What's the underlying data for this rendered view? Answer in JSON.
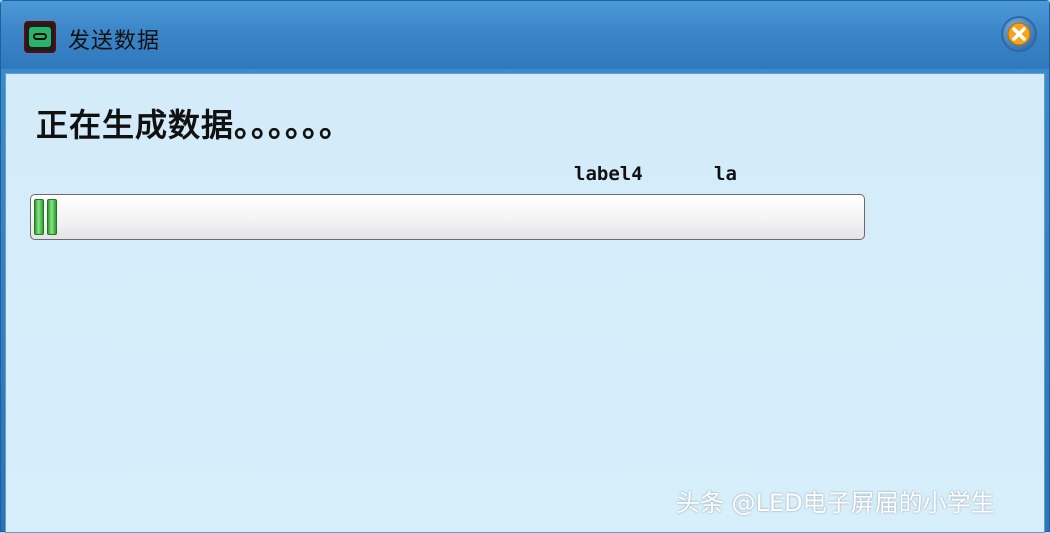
{
  "window": {
    "title": "发送数据",
    "close_icon": "close-icon",
    "accent_color": "#2f7dc2"
  },
  "content": {
    "status_text": "正在生成数据。。。。。。",
    "label4": "label4",
    "label5": "la",
    "progress": {
      "value_fraction": 0.03,
      "fill_color": "#3fbf3f"
    }
  },
  "watermark": {
    "text": "头条 @LED电子屏届的小学生"
  }
}
